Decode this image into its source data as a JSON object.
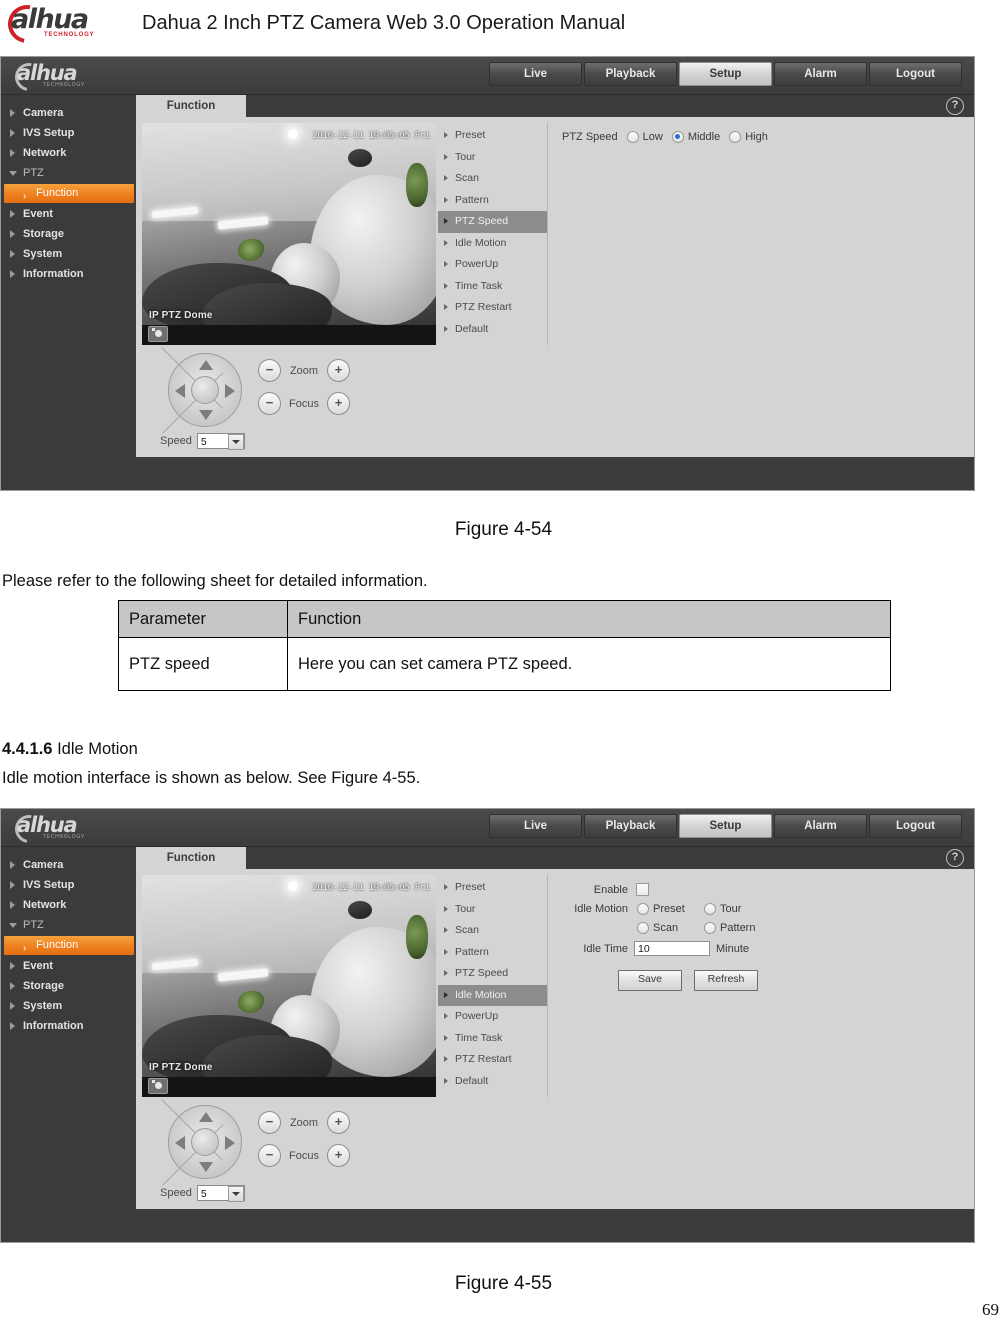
{
  "document": {
    "header_title": "Dahua 2 Inch PTZ Camera Web 3.0 Operation Manual",
    "logo_word": "alhua",
    "logo_sub": "TECHNOLOGY",
    "figure_54_caption": "Figure 4-54",
    "intro_paragraph": "Please refer to the following sheet for detailed information.",
    "section_number": "4.4.1.6",
    "section_title": "Idle Motion",
    "section_body": "Idle motion interface is shown as below. See Figure 4-55.",
    "figure_55_caption": "Figure 4-55",
    "page_number": "69"
  },
  "table": {
    "headers": [
      "Parameter",
      "Function"
    ],
    "rows": [
      [
        "PTZ speed",
        "Here you can set camera PTZ speed."
      ]
    ]
  },
  "ui": {
    "logo_word": "alhua",
    "logo_sub": "TECHNOLOGY",
    "top_nav": [
      {
        "label": "Live",
        "active": false
      },
      {
        "label": "Playback",
        "active": false
      },
      {
        "label": "Setup",
        "active": true
      },
      {
        "label": "Alarm",
        "active": false
      },
      {
        "label": "Logout",
        "active": false
      }
    ],
    "sidebar": [
      {
        "label": "Camera",
        "type": "item"
      },
      {
        "label": "IVS Setup",
        "type": "item"
      },
      {
        "label": "Network",
        "type": "item"
      },
      {
        "label": "PTZ",
        "type": "expanded"
      },
      {
        "label": "Function",
        "type": "sub-selected"
      },
      {
        "label": "Event",
        "type": "item"
      },
      {
        "label": "Storage",
        "type": "item"
      },
      {
        "label": "System",
        "type": "item"
      },
      {
        "label": "Information",
        "type": "item"
      }
    ],
    "tab_label": "Function",
    "help_icon": "?",
    "function_menu": [
      "Preset",
      "Tour",
      "Scan",
      "Pattern",
      "PTZ Speed",
      "Idle Motion",
      "PowerUp",
      "Time Task",
      "PTZ Restart",
      "Default"
    ],
    "video": {
      "timestamp": "2016-12-11 19:05:05 Fri",
      "camera_name": "IP PTZ Dome",
      "snapshot_icon": "camera-icon"
    },
    "ptz_control": {
      "zoom_label": "Zoom",
      "focus_label": "Focus",
      "minus": "−",
      "plus": "+",
      "speed_label": "Speed",
      "speed_value": "5"
    }
  },
  "figure_54_panel": {
    "selected_menu": "PTZ Speed",
    "ptz_speed_label": "PTZ Speed",
    "options": [
      {
        "label": "Low",
        "selected": false
      },
      {
        "label": "Middle",
        "selected": true
      },
      {
        "label": "High",
        "selected": false
      }
    ]
  },
  "figure_55_panel": {
    "selected_menu": "Idle Motion",
    "enable_label": "Enable",
    "enable_checked": false,
    "idle_motion_label": "Idle Motion",
    "motion_options_row1": [
      {
        "label": "Preset",
        "selected": false
      },
      {
        "label": "Tour",
        "selected": false
      }
    ],
    "motion_options_row2": [
      {
        "label": "Scan",
        "selected": false
      },
      {
        "label": "Pattern",
        "selected": false
      }
    ],
    "idle_time_label": "Idle Time",
    "idle_time_value": "10",
    "idle_time_unit": "Minute",
    "save_label": "Save",
    "refresh_label": "Refresh"
  },
  "colors": {
    "accent_orange": "#ee7f1e",
    "dark_chrome": "#3b3b3b",
    "panel_gray": "#d4d4d4",
    "logo_red": "#cf2027"
  }
}
